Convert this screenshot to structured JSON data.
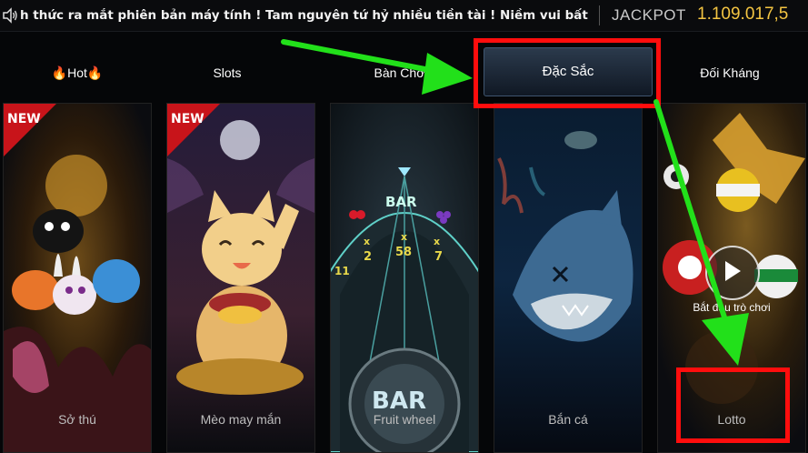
{
  "ticker": {
    "message": "h thức ra mắt phiên bản máy tính ! Tam nguyên tứ hỷ nhiều tiền tài ! Niềm vui bất",
    "jackpot_label": "JACKPOT",
    "jackpot_value": "1.109.017,5"
  },
  "tabs": [
    {
      "label": "Hot",
      "active": false
    },
    {
      "label": "Slots",
      "active": false
    },
    {
      "label": "Bàn Chơi",
      "active": false
    },
    {
      "label": "Đặc Sắc",
      "active": true
    },
    {
      "label": "Đối Kháng",
      "active": false
    }
  ],
  "games": [
    {
      "name": "Sở thú",
      "badge": "NEW"
    },
    {
      "name": "Mèo may mắn",
      "badge": "NEW"
    },
    {
      "name": "Fruit wheel",
      "wheel_text": {
        "bar": "BAR",
        "mult": "x",
        "m1": "2",
        "m2": "58",
        "m3": "7",
        "m4": "11"
      }
    },
    {
      "name": "Bắn cá"
    },
    {
      "name": "Lotto",
      "hover_caption": "Bắt đầu trò chơi"
    }
  ],
  "colors": {
    "jackpot": "#f4c542",
    "highlight": "#ff0d0d",
    "arrow": "#22e01a",
    "active_tab": "#1c2a3a"
  }
}
